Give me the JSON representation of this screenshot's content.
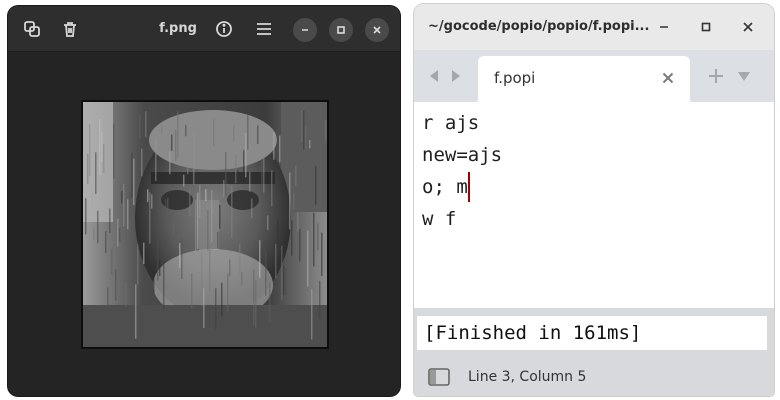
{
  "viewer": {
    "title": "f.png",
    "icons": {
      "copy": "copy-icon",
      "delete": "trash-icon",
      "info": "info-icon",
      "menu": "hamburger-menu-icon",
      "minimize": "minimize-icon",
      "maximize": "maximize-icon",
      "close": "close-icon"
    },
    "image_alt": "glitched grayscale portrait"
  },
  "editor": {
    "title": "~/gocode/popio/popio/f.popi...",
    "tab_label": "f.popi",
    "lines": [
      "r ajs",
      "new=ajs",
      "o; m",
      "w f"
    ],
    "output": "[Finished in 161ms]",
    "status": "Line 3, Column 5",
    "colors": {
      "caret": "#a00000",
      "tabbar": "#dcdfe3",
      "panel": "#d7d9dc"
    }
  }
}
